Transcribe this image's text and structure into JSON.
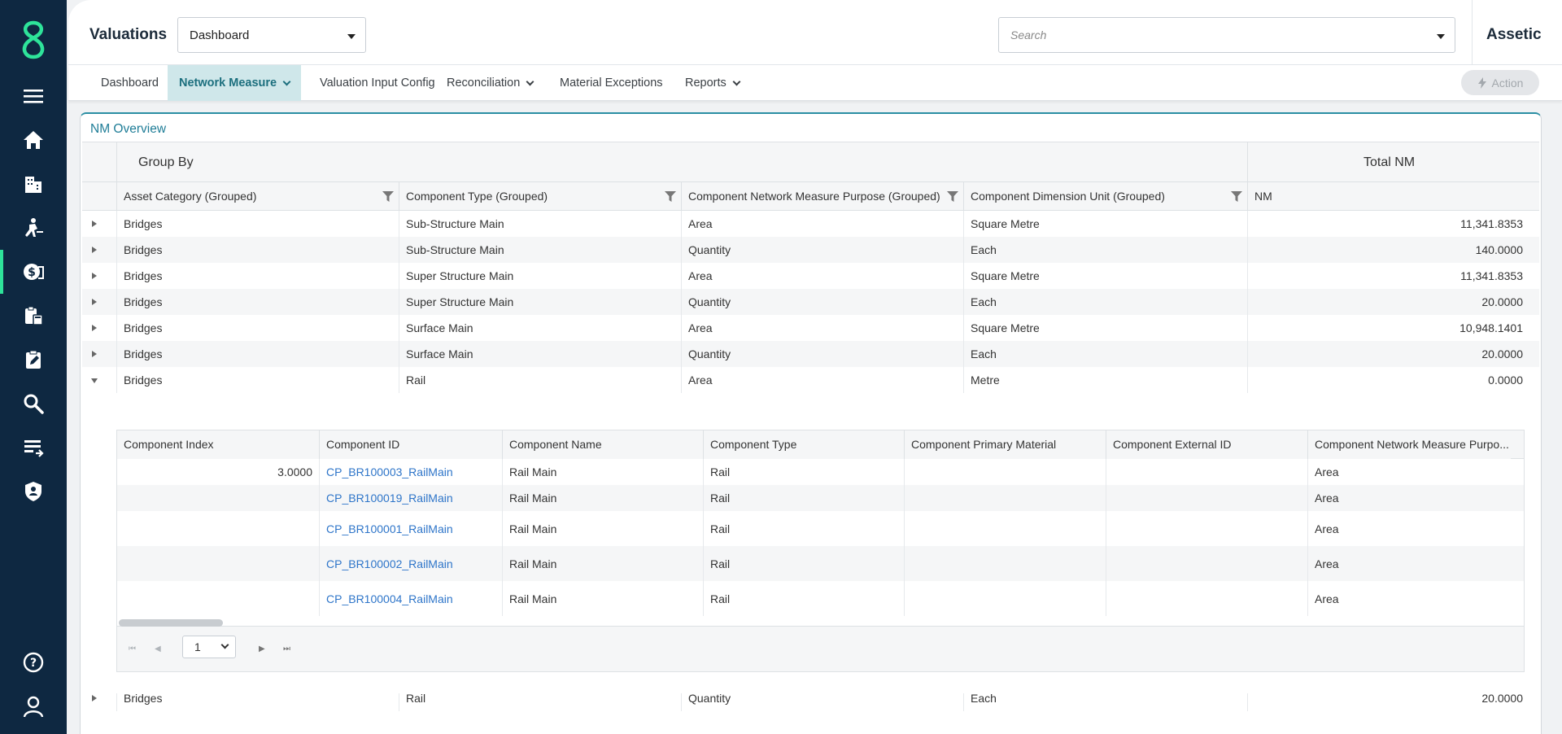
{
  "sidebar": {
    "items": [
      {
        "icon": "menu-icon"
      },
      {
        "icon": "home-icon"
      },
      {
        "icon": "buildings-icon"
      },
      {
        "icon": "maintenance-worker-icon"
      },
      {
        "icon": "valuations-money-icon",
        "active": true
      },
      {
        "icon": "clipboard-calc-icon"
      },
      {
        "icon": "clipboard-edit-icon"
      },
      {
        "icon": "search-icon"
      },
      {
        "icon": "list-import-icon"
      },
      {
        "icon": "shield-user-icon"
      },
      {
        "icon": "help-icon"
      },
      {
        "icon": "user-icon"
      }
    ],
    "accent": "#2ee39a",
    "bg": "#0e2841"
  },
  "header": {
    "title": "Valuations",
    "dashboard_select": "Dashboard",
    "search_placeholder": "Search",
    "brand": "Assetic"
  },
  "nav": {
    "tabs": [
      {
        "label": "Dashboard",
        "dropdown": false,
        "active": false
      },
      {
        "label": "Network Measure",
        "dropdown": true,
        "active": true
      },
      {
        "label": "Valuation Input Config",
        "dropdown": false,
        "active": false
      },
      {
        "label": "Reconciliation",
        "dropdown": true,
        "active": false
      },
      {
        "label": "Material Exceptions",
        "dropdown": false,
        "active": false
      },
      {
        "label": "Reports",
        "dropdown": true,
        "active": false
      }
    ],
    "action_label": "Action"
  },
  "panel": {
    "title": "NM Overview",
    "group_by_label": "Group By",
    "total_nm_label": "Total NM",
    "columns": [
      "Asset Category (Grouped)",
      "Component Type (Grouped)",
      "Component Network Measure Purpose (Grouped)",
      "Component Dimension Unit (Grouped)",
      "NM"
    ],
    "rows": [
      {
        "category": "Bridges",
        "type": "Sub-Structure Main",
        "purpose": "Area",
        "unit": "Square Metre",
        "nm": "11,341.8353"
      },
      {
        "category": "Bridges",
        "type": "Sub-Structure Main",
        "purpose": "Quantity",
        "unit": "Each",
        "nm": "140.0000"
      },
      {
        "category": "Bridges",
        "type": "Super Structure Main",
        "purpose": "Area",
        "unit": "Square Metre",
        "nm": "11,341.8353"
      },
      {
        "category": "Bridges",
        "type": "Super Structure Main",
        "purpose": "Quantity",
        "unit": "Each",
        "nm": "20.0000"
      },
      {
        "category": "Bridges",
        "type": "Surface Main",
        "purpose": "Area",
        "unit": "Square Metre",
        "nm": "10,948.1401"
      },
      {
        "category": "Bridges",
        "type": "Surface Main",
        "purpose": "Quantity",
        "unit": "Each",
        "nm": "20.0000"
      },
      {
        "category": "Bridges",
        "type": "Rail",
        "purpose": "Area",
        "unit": "Metre",
        "nm": "0.0000"
      }
    ],
    "last_row": {
      "category": "Bridges",
      "type": "Rail",
      "purpose": "Quantity",
      "unit": "Each",
      "nm": "20.0000"
    },
    "detail": {
      "columns": [
        "Component Index",
        "Component ID",
        "Component Name",
        "Component Type",
        "Component Primary Material",
        "Component External ID",
        "Component Network Measure Purpo..."
      ],
      "rows": [
        {
          "index": "3.0000",
          "id": "CP_BR100003_RailMain",
          "name": "Rail Main",
          "type": "Rail",
          "material": "",
          "external": "",
          "purpose": "Area"
        },
        {
          "index": "",
          "id": "CP_BR100019_RailMain",
          "name": "Rail Main",
          "type": "Rail",
          "material": "",
          "external": "",
          "purpose": "Area"
        },
        {
          "index": "",
          "id": "CP_BR100001_RailMain",
          "name": "Rail Main",
          "type": "Rail",
          "material": "",
          "external": "",
          "purpose": "Area"
        },
        {
          "index": "",
          "id": "CP_BR100002_RailMain",
          "name": "Rail Main",
          "type": "Rail",
          "material": "",
          "external": "",
          "purpose": "Area"
        },
        {
          "index": "",
          "id": "CP_BR100004_RailMain",
          "name": "Rail Main",
          "type": "Rail",
          "material": "",
          "external": "",
          "purpose": "Area"
        }
      ],
      "page": "1"
    }
  }
}
